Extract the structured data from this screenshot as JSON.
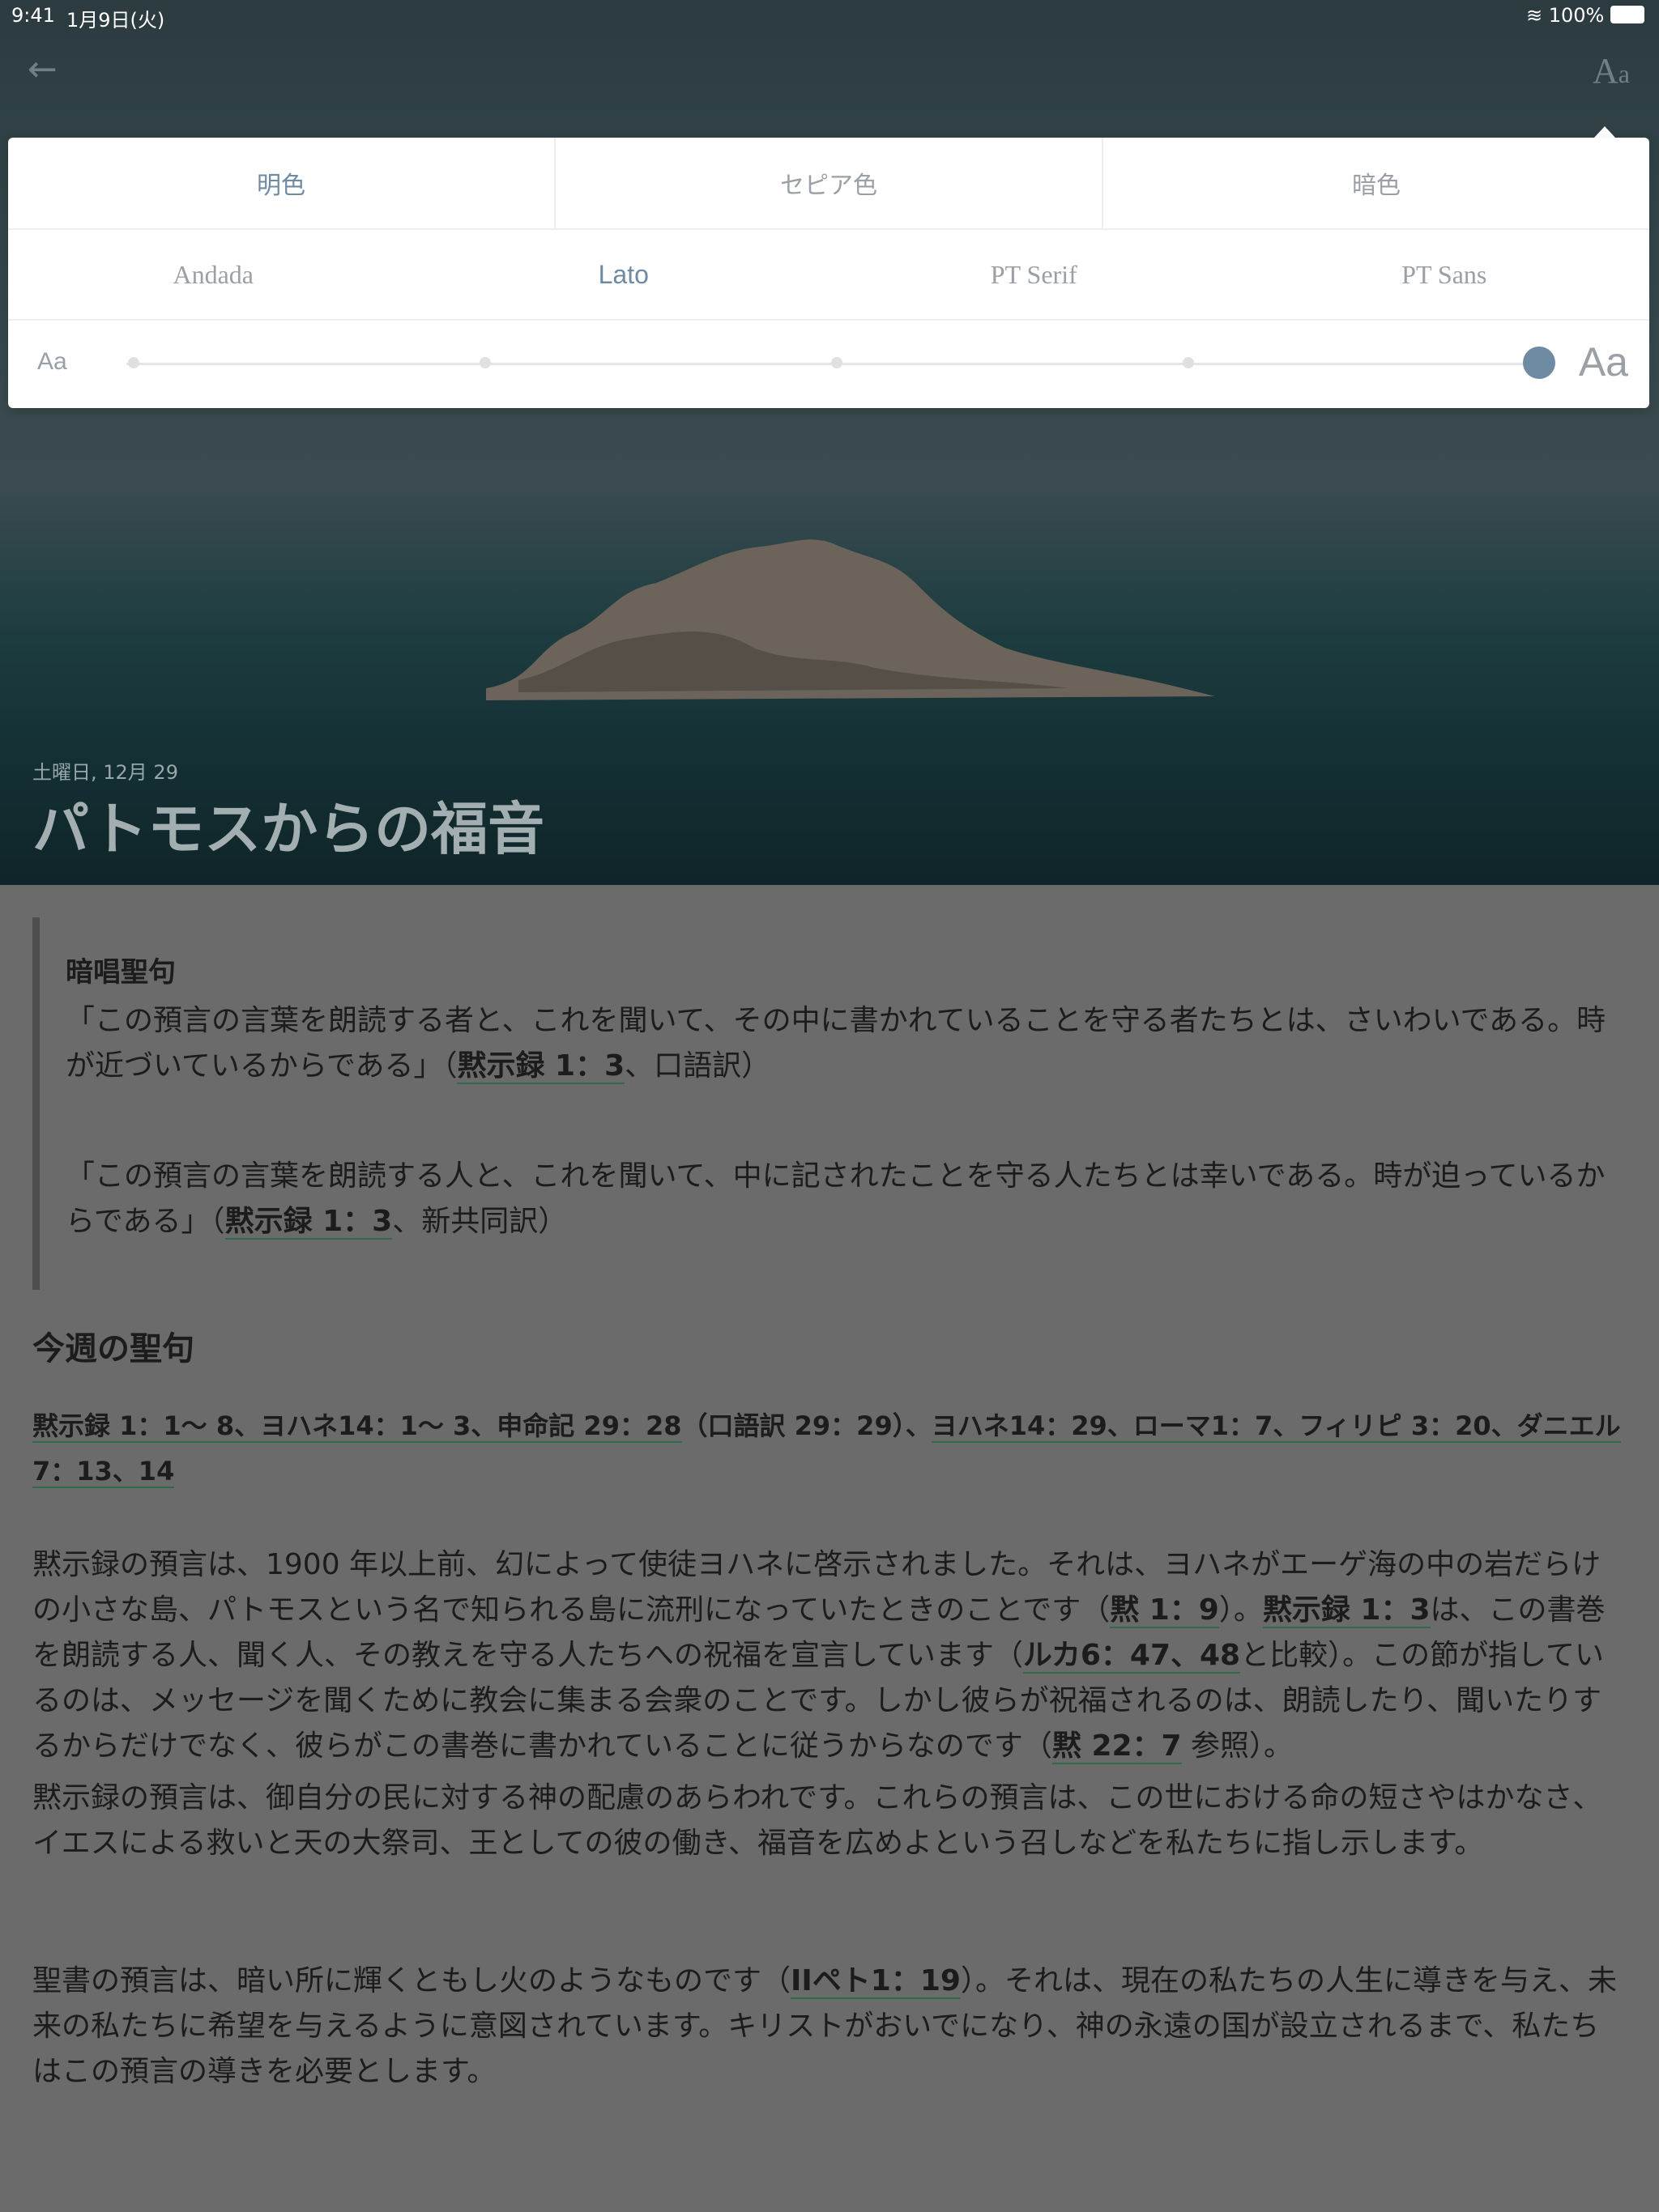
{
  "status": {
    "time": "9:41",
    "date": "1月9日(火)",
    "battery": "100%"
  },
  "nav": {
    "back_icon": "arrow-left-icon",
    "font_icon_big": "A",
    "font_icon_small": "a"
  },
  "hero": {
    "date": "土曜日, 12月 29",
    "title": "パトモスからの福音"
  },
  "settings": {
    "themes": [
      "明色",
      "セピア色",
      "暗色"
    ],
    "active_theme": "明色",
    "fonts": [
      "Andada",
      "Lato",
      "PT Serif",
      "PT Sans"
    ],
    "active_font": "Lato",
    "size_small_label": "Aa",
    "size_large_label": "Aa",
    "size_level": 5,
    "size_levels": 5
  },
  "memory": {
    "title": "暗唱聖句",
    "p1_text": "「この預言の言葉を朗読する者と、これを聞いて、その中に書かれていることを守る者たちとは、さいわいである。時が近づいているからである」（",
    "p1_ref": "黙示録 1：3",
    "p1_end": "、口語訳）",
    "p2_text": "「この預言の言葉を朗読する人と、これを聞いて、中に記されたことを守る人たちとは幸いである。時が迫っているからである」（",
    "p2_ref": "黙示録 1：3",
    "p2_end": "、新共同訳）"
  },
  "week": {
    "title": "今週の聖句",
    "ref1": "黙示録 1：1〜 8、ヨハネ14：1〜 3、申命記 29：28",
    "mid": "（口語訳 29：29）、",
    "ref2": "ヨハネ14：29、ローマ1：7、フィリピ 3：20、ダニエル 7：13、14"
  },
  "body": {
    "p1_a": "黙示録の預言は、1900 年以上前、幻によって使徒ヨハネに啓示されました。それは、ヨハネがエーゲ海の中の岩だらけの小さな島、パトモスという名で知られる島に流刑になっていたときのことです（",
    "p1_ref1": "黙 1：9",
    "p1_b": "）。",
    "p1_ref2": "黙示録 1：3",
    "p1_c": "は、この書巻を朗読する人、聞く人、その教えを守る人たちへの祝福を宣言しています（",
    "p1_ref3": "ルカ6：47、48",
    "p1_d": "と比較）。この節が指しているのは、メッセージを聞くために教会に集まる会衆のことです。しかし彼らが祝福されるのは、朗読したり、聞いたりするからだけでなく、彼らがこの書巻に書かれていることに従うからなのです（",
    "p1_ref4": "黙 22：7",
    "p1_e": " 参照）。",
    "p2": "黙示録の預言は、御自分の民に対する神の配慮のあらわれです。これらの預言は、この世における命の短さやはかなさ、イエスによる救いと天の大祭司、王としての彼の働き、福音を広めよという召しなどを私たちに指し示します。",
    "p3_a": "聖書の預言は、暗い所に輝くともし火のようなものです（",
    "p3_ref": "IIペト1：19",
    "p3_b": "）。それは、現在の私たちの人生に導きを与え、未来の私たちに希望を与えるように意図されています。キリストがおいでになり、神の永遠の国が設立されるまで、私たちはこの預言の導きを必要とします。"
  },
  "colors": {
    "accent": "#6f8aa3",
    "link_underline": "#2f6a4a",
    "overlay": "#6b6b6b"
  }
}
